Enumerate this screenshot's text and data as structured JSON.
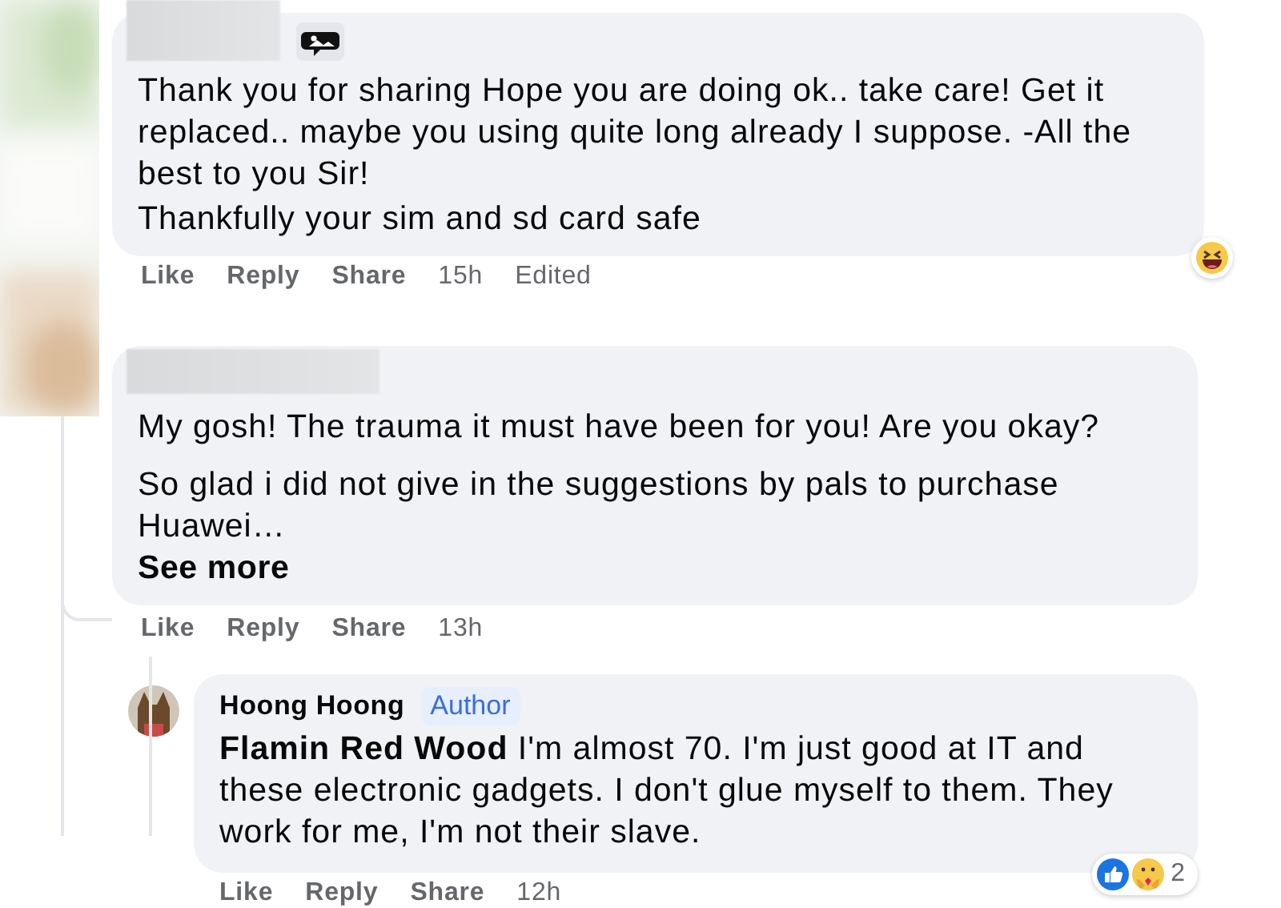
{
  "comments": [
    {
      "has_sticker": true,
      "paragraphs": [
        "Thank you for sharing Hope you are doing ok.. take care! Get it replaced.. maybe you using quite long already I suppose. -All the best to you Sir!",
        "Thankfully your sim and sd card safe"
      ],
      "actions": [
        "Like",
        "Reply",
        "Share"
      ],
      "time": "15h",
      "edited": "Edited",
      "reactions": [
        {
          "kind": "haha"
        }
      ]
    },
    {
      "has_sticker": false,
      "paragraphs": [
        "My gosh! The trauma it must have been for you! Are you okay?",
        "So glad i did not give in the suggestions by pals to purchase Huawei…"
      ],
      "see_more": "See more",
      "actions": [
        "Like",
        "Reply",
        "Share"
      ],
      "time": "13h"
    }
  ],
  "reply": {
    "author": "Hoong Hoong",
    "badge": "Author",
    "text": "**Flamin Red Wood** I'm almost 70. I'm just good at IT and these electronic gadgets. I don't glue myself to them. They work for me, I'm not their slave.",
    "actions": [
      "Like",
      "Reply",
      "Share"
    ],
    "time": "12h",
    "reactions": [
      {
        "kind": "like"
      },
      {
        "kind": "care"
      }
    ],
    "reaction_count": "2"
  }
}
